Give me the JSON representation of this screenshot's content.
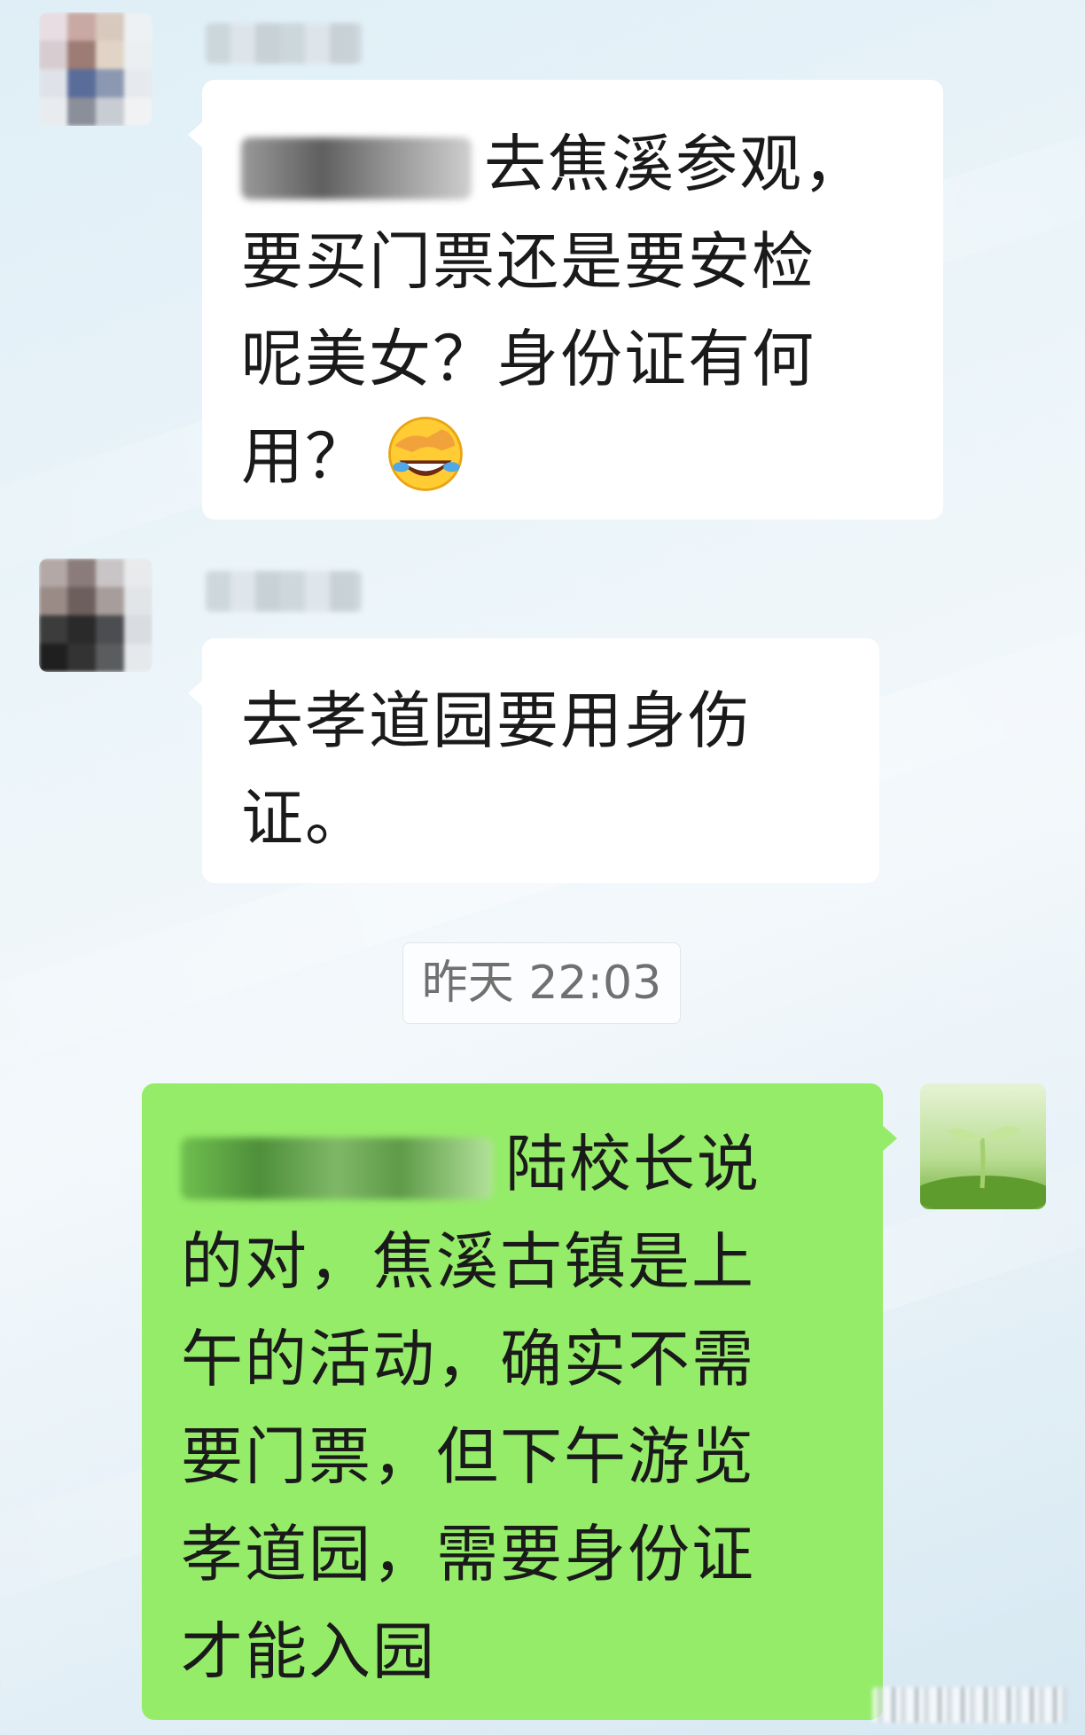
{
  "chat": {
    "messages": [
      {
        "sender": "other",
        "lines": [
          "去焦溪参观，",
          "要买门票还是要安检",
          "呢美女？身份证有何",
          "用？"
        ],
        "emoji": "rolling-on-floor-laughing-emoji"
      },
      {
        "sender": "other",
        "lines": [
          "去孝道园要用身伤",
          "证。"
        ]
      },
      {
        "sender": "me",
        "lines": [
          "陆校长说",
          "的对，焦溪古镇是上",
          "午的活动，确实不需",
          "要门票，但下午游览",
          "孝道园，需要身份证",
          "才能入园"
        ]
      }
    ],
    "timestamp": "昨天 22:03"
  },
  "colors": {
    "incoming_bubble": "#ffffff",
    "outgoing_bubble": "#95ec69",
    "timestamp_text": "#707070",
    "message_text": "#1a1a1a"
  }
}
